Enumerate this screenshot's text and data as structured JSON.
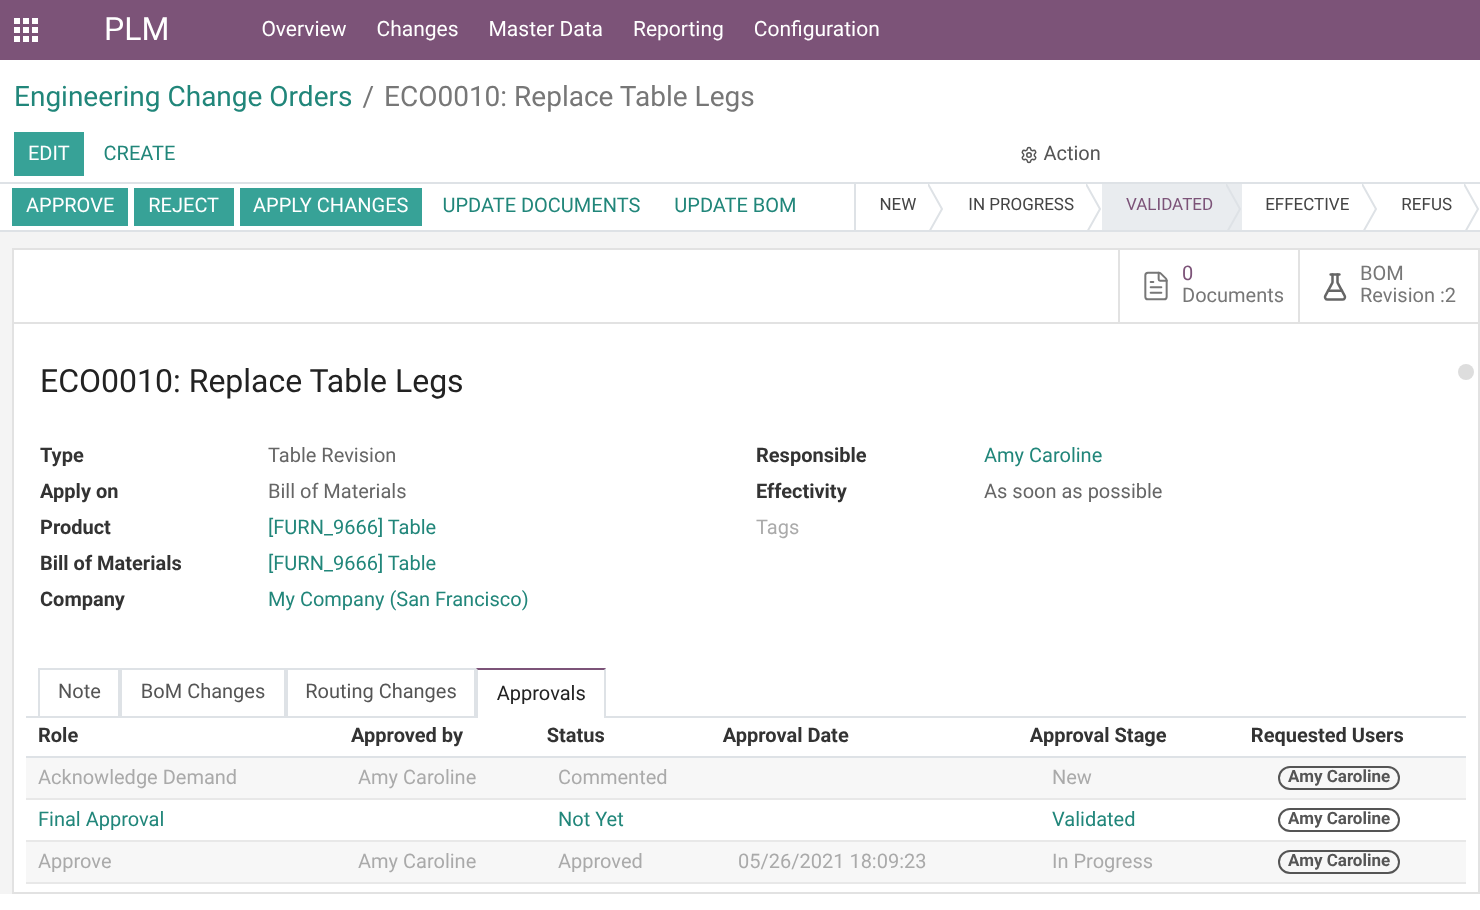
{
  "app_bar": {
    "app_name": "PLM",
    "menu": [
      "Overview",
      "Changes",
      "Master Data",
      "Reporting",
      "Configuration"
    ]
  },
  "breadcrumb": {
    "parent": "Engineering Change Orders",
    "separator": "/",
    "current": "ECO0010: Replace Table Legs"
  },
  "control_panel": {
    "edit": "EDIT",
    "create": "CREATE",
    "action": "Action"
  },
  "header_buttons": [
    {
      "label": "APPROVE",
      "kind": "primary"
    },
    {
      "label": "REJECT",
      "kind": "primary"
    },
    {
      "label": "APPLY CHANGES",
      "kind": "primary"
    },
    {
      "label": "UPDATE DOCUMENTS",
      "kind": "link"
    },
    {
      "label": "UPDATE BOM",
      "kind": "link"
    }
  ],
  "stages": [
    {
      "label": "NEW",
      "selected": false
    },
    {
      "label": "IN PROGRESS",
      "selected": false
    },
    {
      "label": "VALIDATED",
      "selected": true
    },
    {
      "label": "EFFECTIVE",
      "selected": false
    },
    {
      "label": "REFUS",
      "selected": false
    }
  ],
  "stat_buttons": [
    {
      "kind": "documents",
      "value": "0",
      "label": "Documents"
    },
    {
      "kind": "bom",
      "value": "BOM",
      "label": "Revision :2"
    }
  ],
  "title": "ECO0010: Replace Table Legs",
  "fields_left": [
    {
      "label": "Type",
      "value": "Table Revision",
      "kind": "text"
    },
    {
      "label": "Apply on",
      "value": "Bill of Materials",
      "kind": "text"
    },
    {
      "label": "Product",
      "value": "[FURN_9666] Table",
      "kind": "link"
    },
    {
      "label": "Bill of Materials",
      "value": "[FURN_9666] Table",
      "kind": "link"
    },
    {
      "label": "Company",
      "value": "My Company (San Francisco)",
      "kind": "link"
    }
  ],
  "fields_right": [
    {
      "label": "Responsible",
      "value": "Amy Caroline",
      "kind": "link"
    },
    {
      "label": "Effectivity",
      "value": "As soon as possible",
      "kind": "text"
    },
    {
      "label": "Tags",
      "kind": "placeholder"
    }
  ],
  "tabs": [
    {
      "label": "Note",
      "selected": false
    },
    {
      "label": "BoM Changes",
      "selected": false
    },
    {
      "label": "Routing Changes",
      "selected": false
    },
    {
      "label": "Approvals",
      "selected": true
    }
  ],
  "table": {
    "columns": [
      "Role",
      "Approved by",
      "Status",
      "Approval Date",
      "Approval Stage",
      "Requested Users"
    ],
    "rows": [
      {
        "kind": "done",
        "cells": [
          "Acknowledge Demand",
          "Amy Caroline",
          "Commented",
          "",
          "New"
        ],
        "users": [
          "Amy Caroline"
        ]
      },
      {
        "kind": "pending",
        "cells": [
          "Final Approval",
          "",
          "Not Yet",
          "",
          "Validated"
        ],
        "users": [
          "Amy Caroline"
        ]
      },
      {
        "kind": "done",
        "cells": [
          "Approve",
          "Amy Caroline",
          "Approved",
          "05/26/2021 18:09:23",
          "In Progress"
        ],
        "users": [
          "Amy Caroline"
        ]
      }
    ]
  }
}
